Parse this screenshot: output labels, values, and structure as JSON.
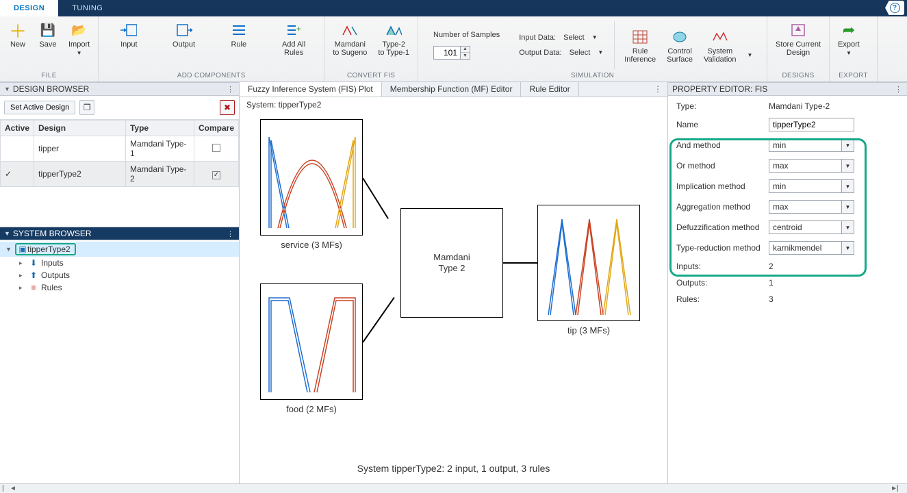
{
  "tabs": {
    "design": "DESIGN",
    "tuning": "TUNING"
  },
  "ribbon": {
    "file": {
      "label": "FILE",
      "new": "New",
      "save": "Save",
      "import": "Import"
    },
    "add": {
      "label": "ADD COMPONENTS",
      "input": "Input",
      "output": "Output",
      "rule": "Rule",
      "addall": "Add All\nRules"
    },
    "convert": {
      "label": "CONVERT FIS",
      "mamdani": "Mamdani\nto Sugeno",
      "type2": "Type-2\nto Type-1"
    },
    "sim": {
      "label": "SIMULATION",
      "numSamples": "Number of Samples",
      "numSamplesVal": "101",
      "inputData": "Input Data:",
      "outputData": "Output Data:",
      "select": "Select",
      "ruleInf": "Rule\nInference",
      "ctrlSurf": "Control\nSurface",
      "sysVal": "System\nValidation"
    },
    "designs": {
      "label": "DESIGNS",
      "store": "Store Current\nDesign"
    },
    "export": {
      "label": "EXPORT",
      "export": "Export"
    }
  },
  "designBrowser": {
    "title": "DESIGN BROWSER",
    "setActive": "Set Active Design",
    "cols": {
      "active": "Active",
      "design": "Design",
      "type": "Type",
      "compare": "Compare"
    },
    "rows": [
      {
        "active": "",
        "design": "tipper",
        "type": "Mamdani Type-1",
        "compare": false
      },
      {
        "active": "✓",
        "design": "tipperType2",
        "type": "Mamdani Type-2",
        "compare": true
      }
    ]
  },
  "systemBrowser": {
    "title": "SYSTEM BROWSER",
    "root": "tipperType2",
    "children": [
      "Inputs",
      "Outputs",
      "Rules"
    ]
  },
  "subtabs": {
    "fis": "Fuzzy Inference System (FIS) Plot",
    "mf": "Membership Function (MF) Editor",
    "rule": "Rule Editor"
  },
  "canvas": {
    "systemLabel": "System: tipperType2",
    "service": "service (3 MFs)",
    "food": "food (2 MFs)",
    "center": "Mamdani\nType 2",
    "tip": "tip (3 MFs)",
    "footer": "System tipperType2: 2 input, 1 output, 3 rules"
  },
  "propertyEditor": {
    "title": "PROPERTY EDITOR: FIS",
    "typeLabel": "Type:",
    "typeVal": "Mamdani Type-2",
    "nameLabel": "Name",
    "nameVal": "tipperType2",
    "andLabel": "And method",
    "andVal": "min",
    "orLabel": "Or method",
    "orVal": "max",
    "impLabel": "Implication method",
    "impVal": "min",
    "aggLabel": "Aggregation method",
    "aggVal": "max",
    "defLabel": "Defuzzification method",
    "defVal": "centroid",
    "trLabel": "Type-reduction method",
    "trVal": "karnikmendel",
    "inputsLabel": "Inputs:",
    "inputsVal": "2",
    "outputsLabel": "Outputs:",
    "outputsVal": "1",
    "rulesLabel": "Rules:",
    "rulesVal": "3"
  }
}
